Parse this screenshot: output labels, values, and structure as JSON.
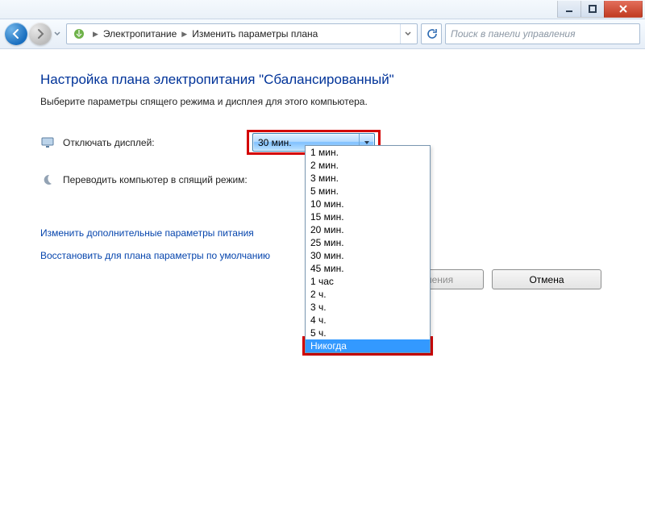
{
  "window_buttons": {
    "min": "minimize-icon",
    "max": "maximize-icon",
    "close": "close-icon"
  },
  "breadcrumb": {
    "parts": [
      "Электропитание",
      "Изменить параметры плана"
    ]
  },
  "search": {
    "placeholder": "Поиск в панели управления"
  },
  "heading": "Настройка плана электропитания \"Сбалансированный\"",
  "subtitle": "Выберите параметры спящего режима и дисплея для этого компьютера.",
  "rows": {
    "display": {
      "label": "Отключать дисплей:",
      "value": "30 мин."
    },
    "sleep": {
      "label": "Переводить компьютер в спящий режим:"
    }
  },
  "dropdown_options": [
    "1 мин.",
    "2 мин.",
    "3 мин.",
    "5 мин.",
    "10 мин.",
    "15 мин.",
    "20 мин.",
    "25 мин.",
    "30 мин.",
    "45 мин.",
    "1 час",
    "2 ч.",
    "3 ч.",
    "4 ч.",
    "5 ч.",
    "Никогда"
  ],
  "dropdown_selected": "Никогда",
  "links": {
    "advanced": "Изменить дополнительные параметры питания",
    "restore": "Восстановить для плана параметры по умолчанию"
  },
  "buttons": {
    "save": "Сохранить изменения",
    "cancel": "Отмена"
  }
}
